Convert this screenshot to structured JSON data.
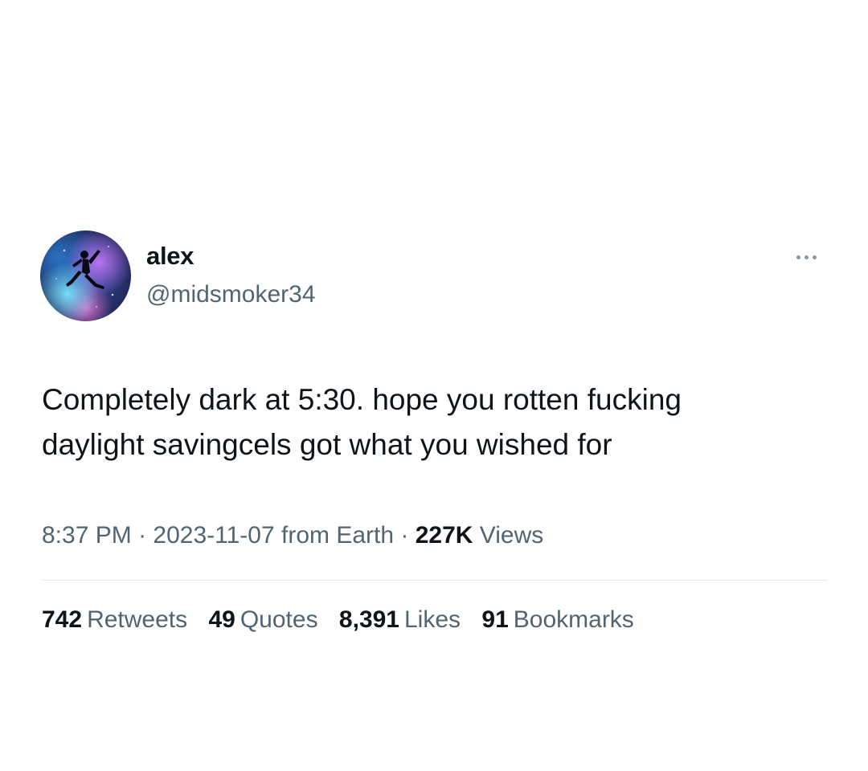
{
  "author": {
    "display_name": "alex",
    "handle": "@midsmoker34",
    "avatar_icon": "jumpman-silhouette-galaxy-avatar"
  },
  "menu": {
    "more_icon": "more-horizontal-icon"
  },
  "tweet": {
    "text": "Completely dark at 5:30. hope you rotten fucking\ndaylight savingcels got what you wished for"
  },
  "meta": {
    "time": "8:37 PM",
    "date": "2023-11-07",
    "source": "from Earth",
    "separator": "·",
    "views_count": "227K",
    "views_label": "Views"
  },
  "stats": {
    "retweets": {
      "count": "742",
      "label": "Retweets"
    },
    "quotes": {
      "count": "49",
      "label": "Quotes"
    },
    "likes": {
      "count": "8,391",
      "label": "Likes"
    },
    "bookmarks": {
      "count": "91",
      "label": "Bookmarks"
    }
  },
  "colors": {
    "text_primary": "#0f1419",
    "text_secondary": "#536471",
    "divider": "#e6e9eb",
    "background": "#ffffff"
  }
}
